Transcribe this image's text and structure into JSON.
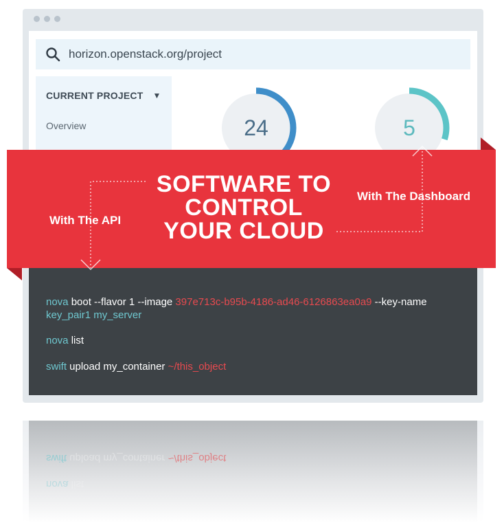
{
  "browser": {
    "url": "horizon.openstack.org/project",
    "icons": {
      "search": "search-icon"
    }
  },
  "sidebar": {
    "current_project_label": "CURRENT PROJECT",
    "items": [
      {
        "label": "Overview"
      }
    ]
  },
  "gauges": [
    {
      "value": "24",
      "color": "#3f8ec9",
      "fill": 0.55
    },
    {
      "value": "5",
      "color": "#5cc4c7",
      "fill": 0.3
    }
  ],
  "banner": {
    "headline_lines": [
      "SOFTWARE TO",
      "CONTROL",
      "YOUR CLOUD"
    ],
    "api_label": "With The API",
    "dashboard_label": "With The Dashboard",
    "color": "#e8343d"
  },
  "terminal": {
    "line1": {
      "cmd": "nova",
      "args1": " boot --flavor 1 --image ",
      "image_id": "397e713c-b95b-4186-ad46-6126863ea0a9",
      "args2": " --key-name",
      "key": "key_pair1",
      "args3": " my_server"
    },
    "line2": {
      "cmd": "nova",
      "args": " list"
    },
    "line3": {
      "cmd": "swift",
      "args": " upload my_container ",
      "path": "~/this_object"
    }
  },
  "colors": {
    "keyword": "#6fc8d0",
    "highlight": "#e84a4f",
    "terminal_bg": "#3d4246"
  }
}
